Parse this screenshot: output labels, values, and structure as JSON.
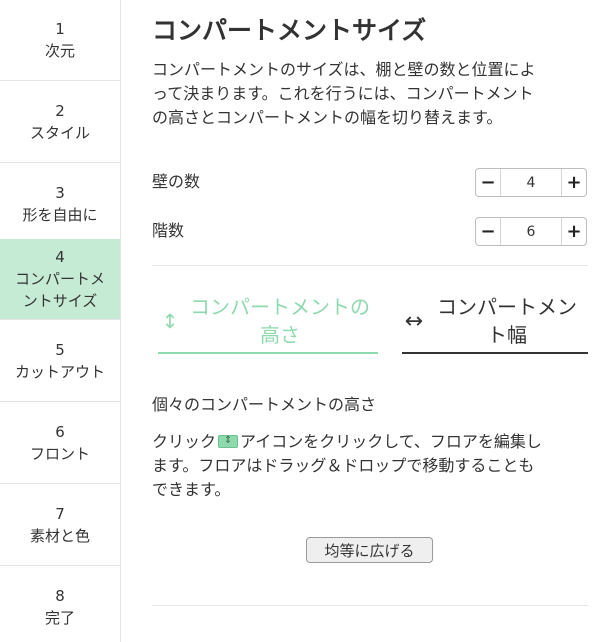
{
  "steps": [
    {
      "num": "1",
      "label": "次元"
    },
    {
      "num": "2",
      "label": "スタイル"
    },
    {
      "num": "3",
      "label": "形を自由に"
    },
    {
      "num": "4",
      "label_line1": "コンパートメ",
      "label_line2": "ントサイズ"
    },
    {
      "num": "5",
      "label": "カットアウト"
    },
    {
      "num": "6",
      "label": "フロント"
    },
    {
      "num": "7",
      "label": "素材と色"
    },
    {
      "num": "8",
      "label": "完了"
    }
  ],
  "active_step": "4",
  "main": {
    "title": "コンパートメントサイズ",
    "desc_line1": "コンパートメントのサイズは、棚と壁の数と位置によ",
    "desc_line2": "って決まります。これを行うには、コンパートメント",
    "desc_line3": "の高さとコンパートメントの幅を切り替えます。",
    "walls": {
      "label": "壁の数",
      "value": "4",
      "minus": "−",
      "plus": "+"
    },
    "floors": {
      "label": "階数",
      "value": "6",
      "minus": "−",
      "plus": "+"
    },
    "tabs": {
      "height": {
        "icon": "↕",
        "line1": "コンパートメントの",
        "line2": "高さ"
      },
      "width": {
        "icon": "↔",
        "line1": "コンパートメン",
        "line2": "ト幅"
      }
    },
    "subhead": "個々のコンパートメントの高さ",
    "help": {
      "prefix": "クリック",
      "line1_suffix": "アイコンをクリックして、フロアを編集し",
      "line2": "ます。フロアはドラッグ＆ドロップで移動することも",
      "line3": "できます。"
    },
    "spread_button": "均等に広げる"
  },
  "colors": {
    "accent": "#8fd9ae",
    "active_step_bg": "#c6ebd4",
    "text": "#333333",
    "divider": "#e6e6e6"
  }
}
